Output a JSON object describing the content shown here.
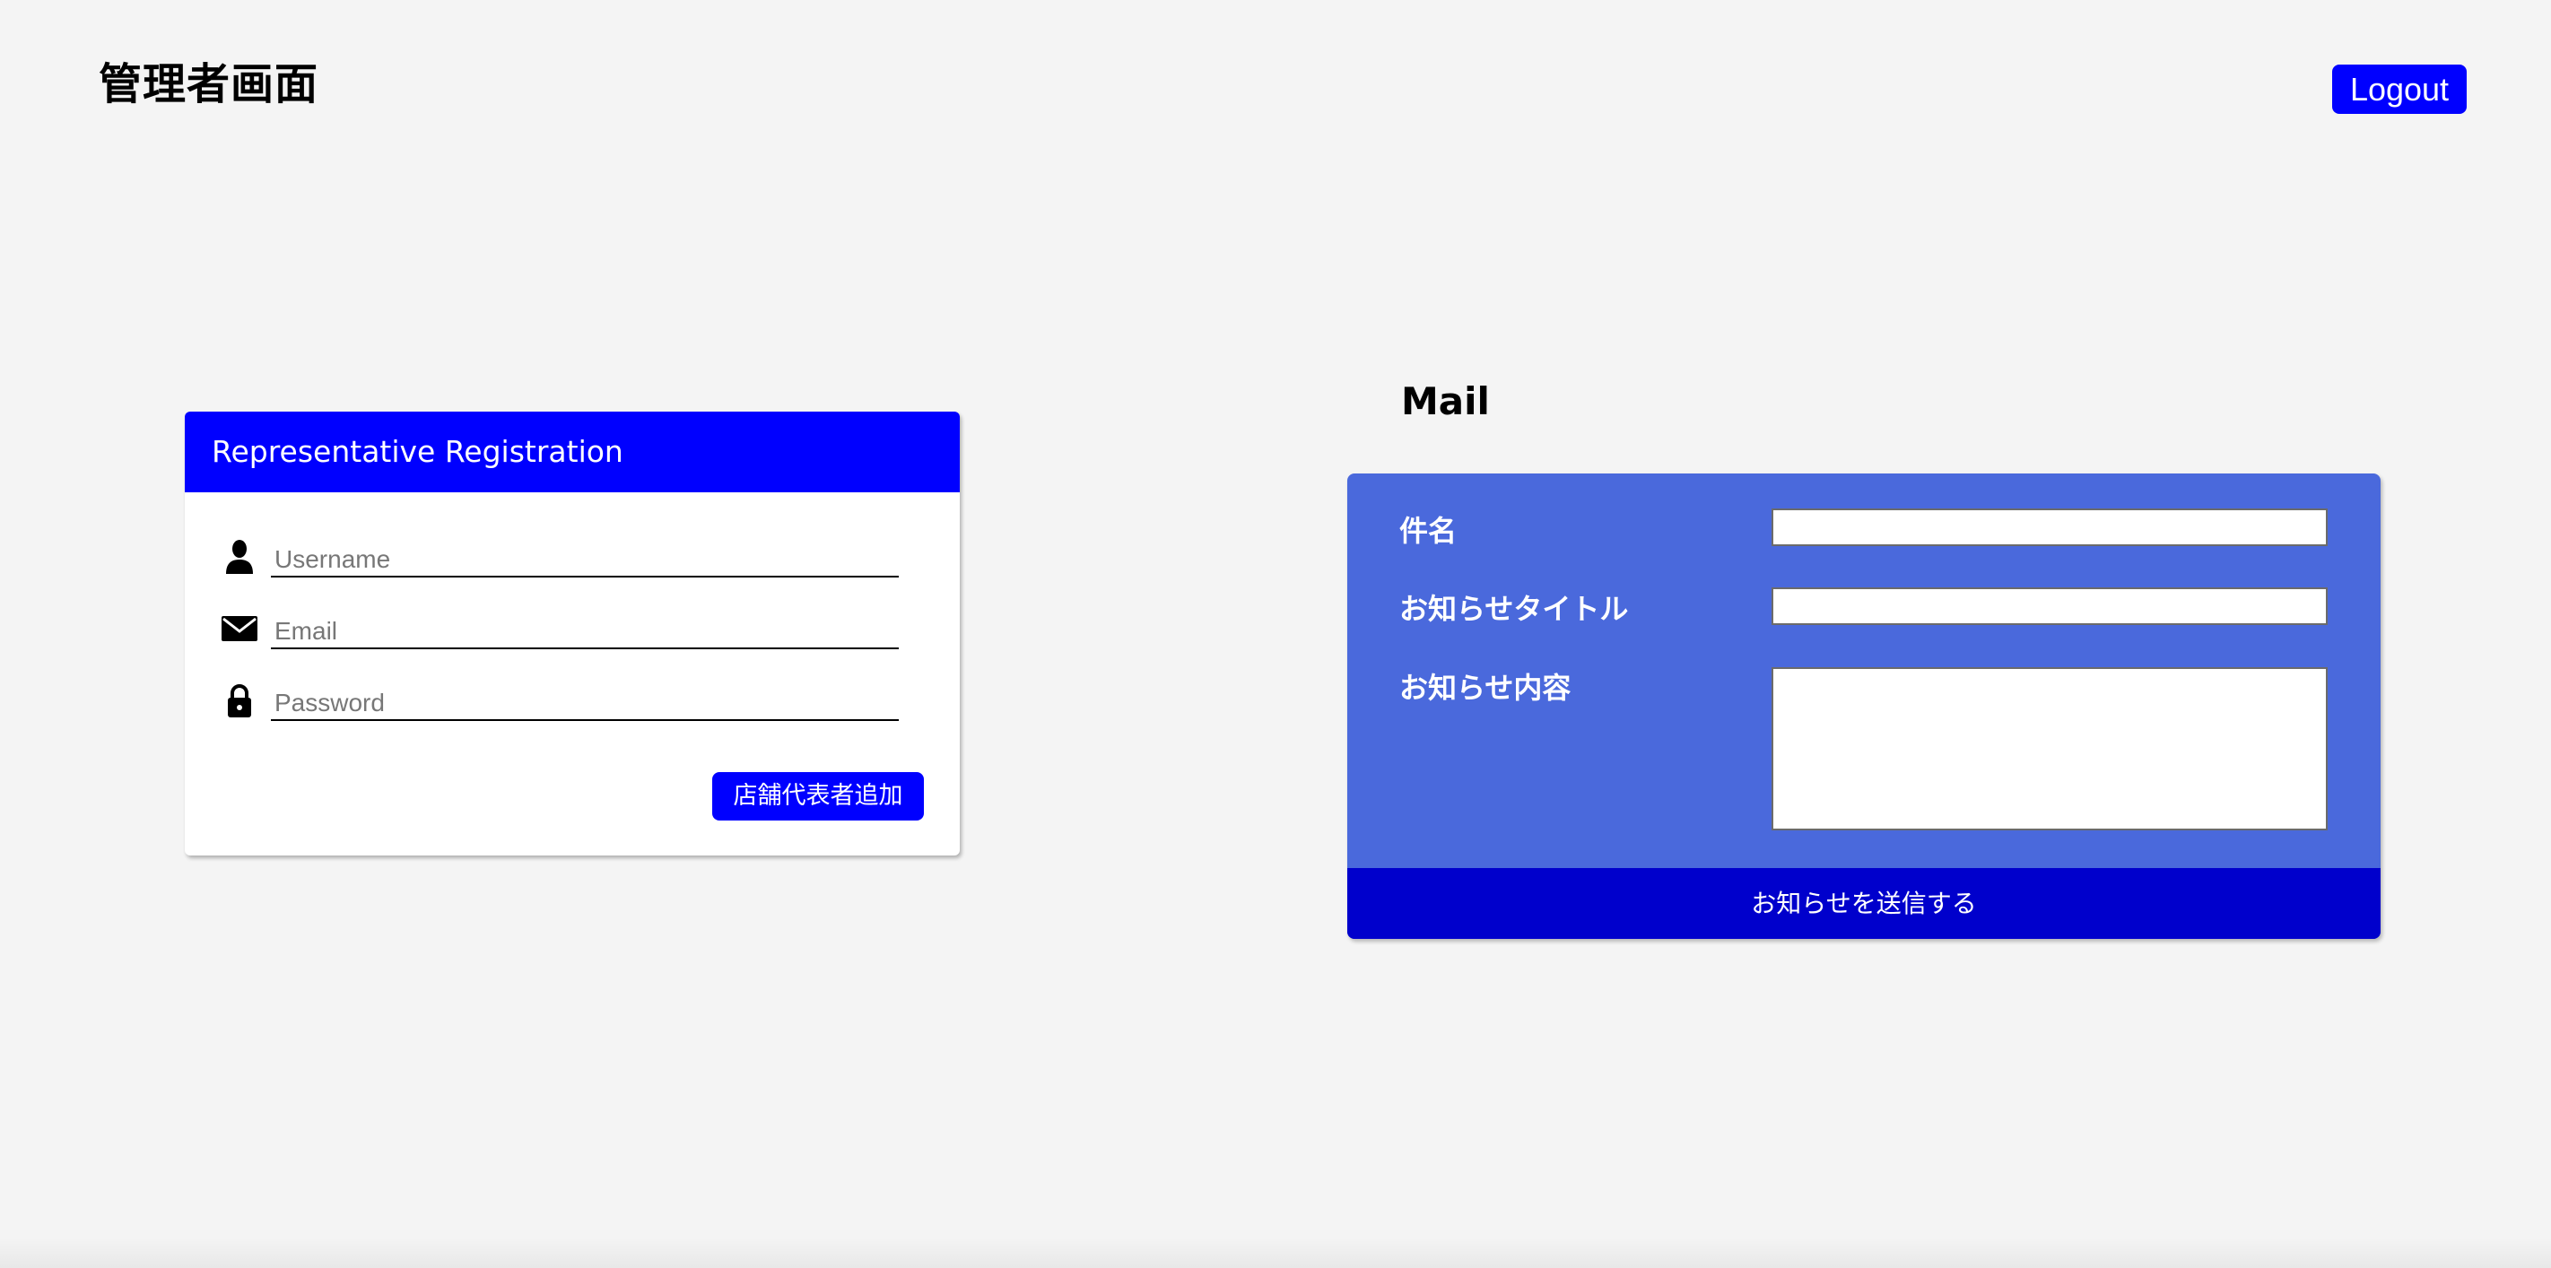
{
  "header": {
    "title": "管理者画面",
    "logout_label": "Logout"
  },
  "registration": {
    "title": "Representative Registration",
    "username_placeholder": "Username",
    "email_placeholder": "Email",
    "password_placeholder": "Password",
    "submit_label": "店舗代表者追加",
    "icons": [
      "user-icon",
      "envelope-icon",
      "lock-icon"
    ]
  },
  "mail": {
    "title": "Mail",
    "subject_label": "件名",
    "notice_title_label": "お知らせタイトル",
    "notice_content_label": "お知らせ内容",
    "send_label": "お知らせを送信する"
  },
  "colors": {
    "background": "#f4f4f4",
    "primary_blue": "#0000ff",
    "mail_panel": "#4a69dc",
    "send_button": "#0000cc"
  }
}
